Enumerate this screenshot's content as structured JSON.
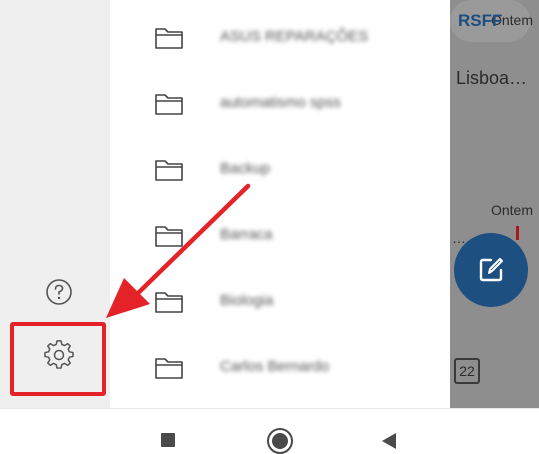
{
  "background_app": {
    "date_top": "Ontem",
    "location": "Lisboa…",
    "chip": "RSFF",
    "date_middle": "Ontem",
    "ellipsis": "…",
    "calendar_day": "22"
  },
  "folders": [
    {
      "label": "ASUS REPARAÇÕES",
      "icon": "folder-icon"
    },
    {
      "label": "automatismo spss",
      "icon": "folder-icon"
    },
    {
      "label": "Backup",
      "icon": "folder-icon"
    },
    {
      "label": "Barraca",
      "icon": "folder-icon"
    },
    {
      "label": "Biologia",
      "icon": "folder-icon"
    },
    {
      "label": "Carlos Bernardo",
      "icon": "folder-icon"
    }
  ],
  "rail": {
    "help_icon": "help-circle-icon",
    "settings_icon": "gear-icon"
  },
  "fab_icon": "compose-icon",
  "annotation": {
    "highlight_color": "#e62229",
    "arrow_color": "#e62229"
  },
  "navbar": {
    "recents_icon": "square-icon",
    "home_icon": "circle-icon",
    "back_icon": "triangle-back-icon"
  },
  "colors": {
    "accent": "#1d4f80",
    "rail_bg": "#efefef",
    "dim_overlay": "#8e8e8e"
  }
}
